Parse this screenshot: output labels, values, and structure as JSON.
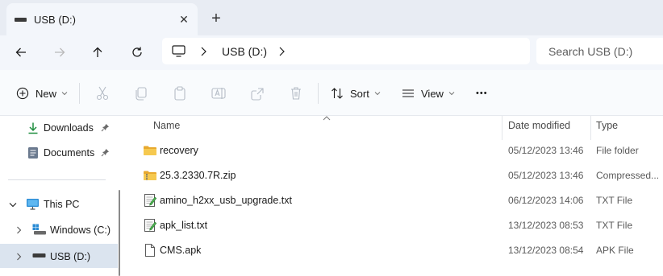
{
  "tab": {
    "title": "USB (D:)",
    "close_glyph": "✕",
    "new_tab_glyph": "+"
  },
  "address": {
    "crumb": "USB (D:)",
    "search_placeholder": "Search USB (D:)"
  },
  "commands": {
    "new": "New",
    "sort": "Sort",
    "view": "View",
    "more": "•••"
  },
  "nav": {
    "items": [
      {
        "label": "Downloads",
        "icon": "download-icon",
        "pinned": true
      },
      {
        "label": "Documents",
        "icon": "documents-icon",
        "pinned": true
      },
      {
        "label": "This PC",
        "icon": "monitor-icon",
        "expanded": true
      },
      {
        "label": "Windows (C:)",
        "icon": "windows-drive-icon"
      },
      {
        "label": "USB (D:)",
        "icon": "usb-drive-icon",
        "selected": true
      }
    ]
  },
  "columns": {
    "name": "Name",
    "date": "Date modified",
    "type": "Type"
  },
  "files": [
    {
      "name": "recovery",
      "date": "05/12/2023 13:46",
      "type": "File folder",
      "icon": "folder-icon"
    },
    {
      "name": "25.3.2330.7R.zip",
      "date": "05/12/2023 13:46",
      "type": "Compressed...",
      "icon": "zip-folder-icon"
    },
    {
      "name": "amino_h2xx_usb_upgrade.txt",
      "date": "06/12/2023 14:06",
      "type": "TXT File",
      "icon": "text-file-icon"
    },
    {
      "name": "apk_list.txt",
      "date": "13/12/2023 08:53",
      "type": "TXT File",
      "icon": "text-file-icon"
    },
    {
      "name": "CMS.apk",
      "date": "13/12/2023 08:54",
      "type": "APK File",
      "icon": "file-icon"
    }
  ],
  "colors": {
    "accent": "#0067c0",
    "selection": "#dbe4ef",
    "folder": "#f4c24d"
  }
}
